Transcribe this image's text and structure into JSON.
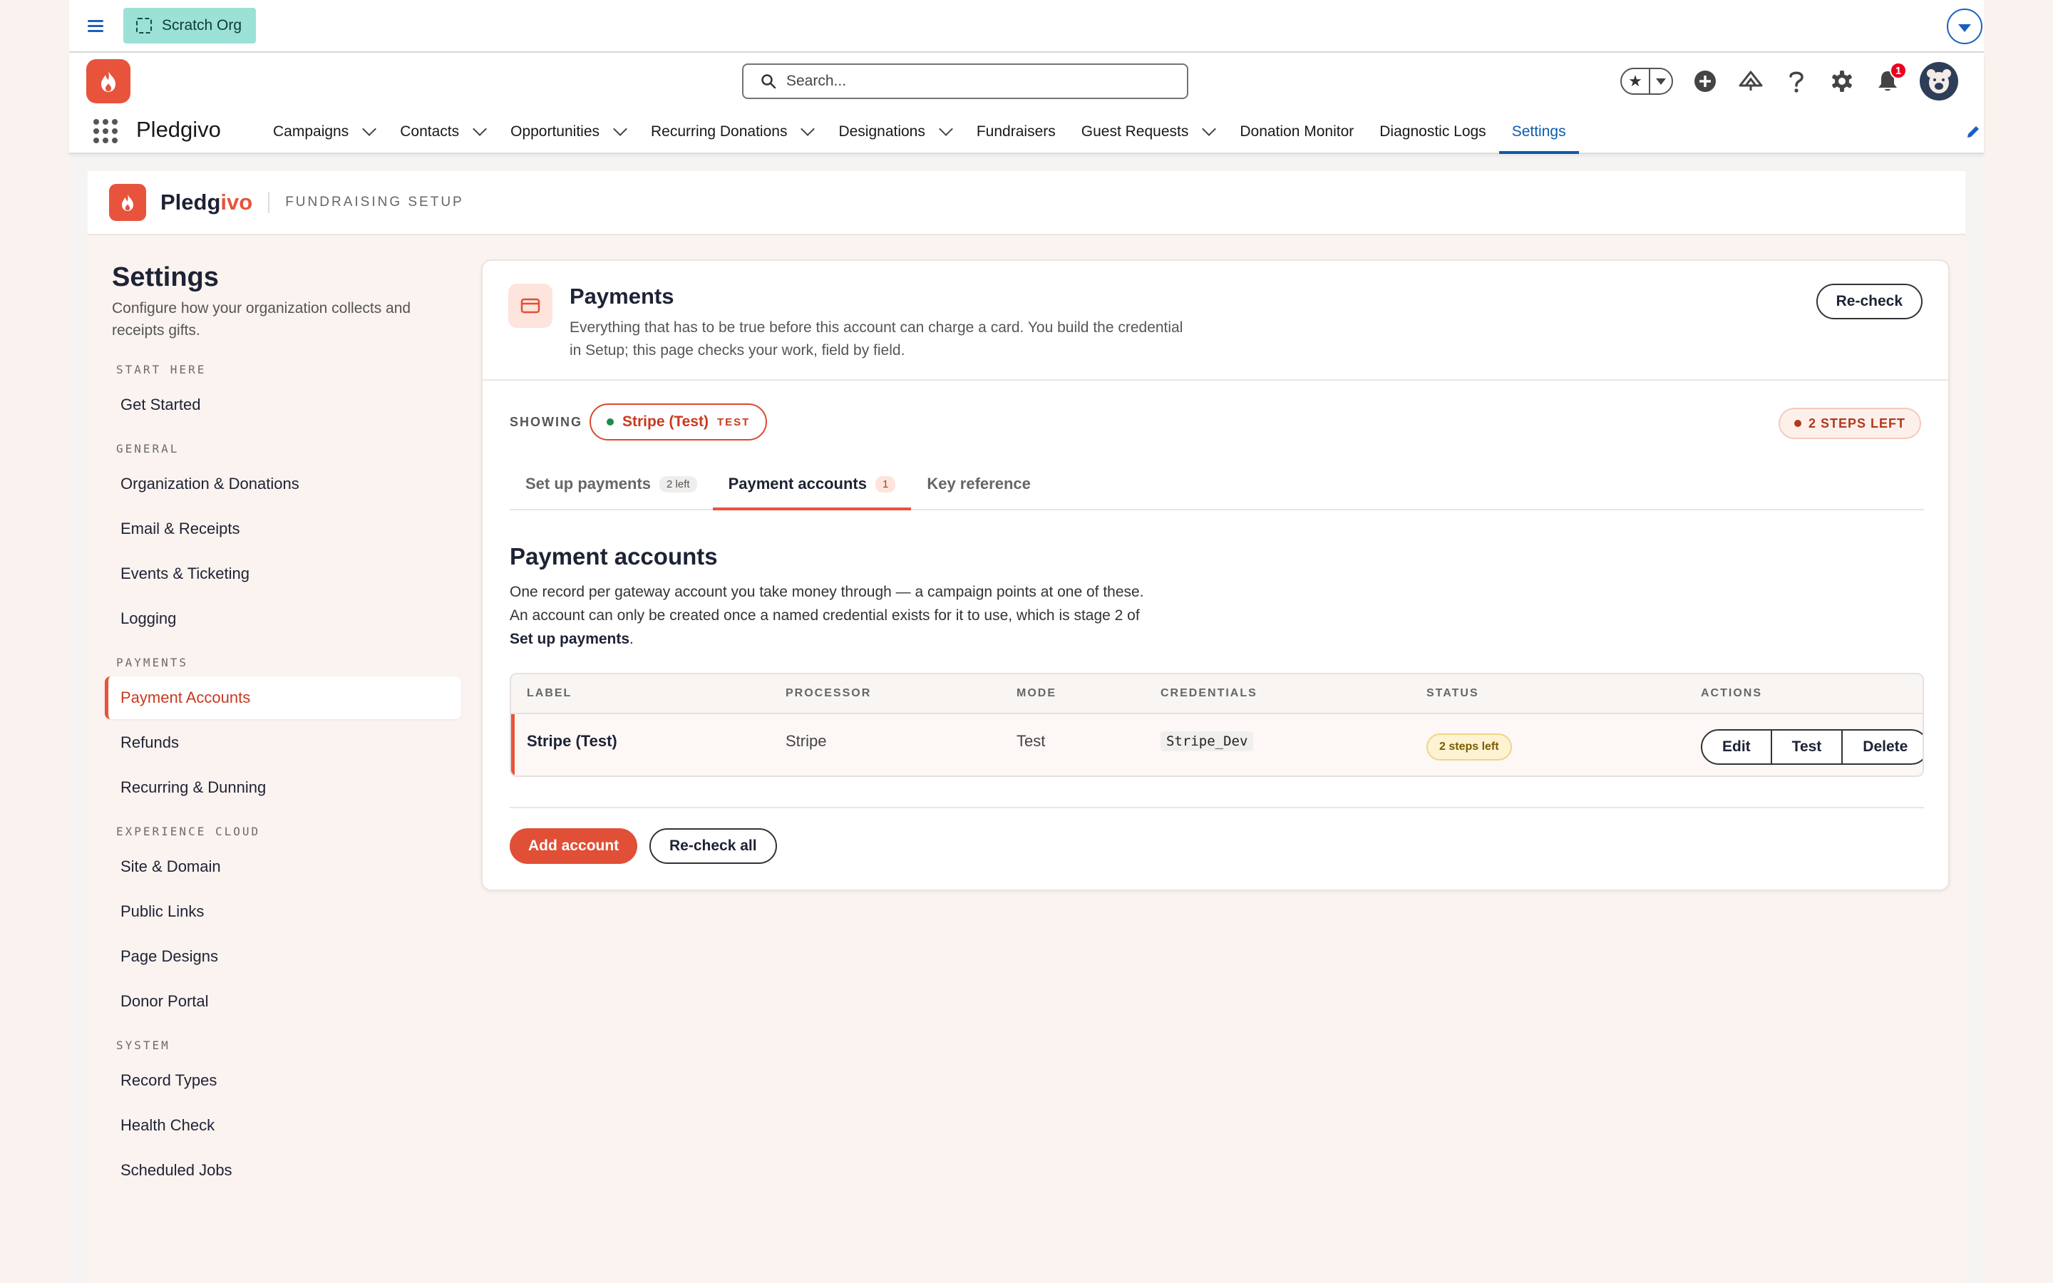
{
  "topbar": {
    "org_label": "Scratch Org"
  },
  "header": {
    "search_placeholder": "Search...",
    "notification_count": "1",
    "app_name": "Pledgivo",
    "nav": [
      {
        "label": "Campaigns",
        "has_menu": true
      },
      {
        "label": "Contacts",
        "has_menu": true
      },
      {
        "label": "Opportunities",
        "has_menu": true
      },
      {
        "label": "Recurring Donations",
        "has_menu": true
      },
      {
        "label": "Designations",
        "has_menu": true
      },
      {
        "label": "Fundraisers",
        "has_menu": false
      },
      {
        "label": "Guest Requests",
        "has_menu": true
      },
      {
        "label": "Donation Monitor",
        "has_menu": false
      },
      {
        "label": "Diagnostic Logs",
        "has_menu": false
      },
      {
        "label": "Settings",
        "has_menu": false,
        "active": true
      }
    ]
  },
  "setup_header": {
    "brand_a": "Pledg",
    "brand_b": "ivo",
    "subtitle": "FUNDRAISING SETUP"
  },
  "sidebar": {
    "title": "Settings",
    "description": "Configure how your organization collects and receipts gifts.",
    "sections": [
      {
        "heading": "START HERE",
        "items": [
          "Get Started"
        ]
      },
      {
        "heading": "GENERAL",
        "items": [
          "Organization & Donations",
          "Email & Receipts",
          "Events & Ticketing",
          "Logging"
        ]
      },
      {
        "heading": "PAYMENTS",
        "items": [
          "Payment Accounts",
          "Refunds",
          "Recurring & Dunning"
        ]
      },
      {
        "heading": "EXPERIENCE CLOUD",
        "items": [
          "Site & Domain",
          "Public Links",
          "Page Designs",
          "Donor Portal"
        ]
      },
      {
        "heading": "SYSTEM",
        "items": [
          "Record Types",
          "Health Check",
          "Scheduled Jobs"
        ]
      }
    ],
    "active_item": "Payment Accounts"
  },
  "card": {
    "title": "Payments",
    "description": "Everything that has to be true before this account can charge a card. You build the credential in Setup; this page checks your work, field by field.",
    "recheck_label": "Re-check",
    "showing_label": "SHOWING",
    "showing_account": "Stripe (Test)",
    "showing_tag": "TEST",
    "steps_left": "2 STEPS LEFT",
    "tabs": [
      {
        "label": "Set up payments",
        "count": "2 left"
      },
      {
        "label": "Payment accounts",
        "count": "1",
        "active": true
      },
      {
        "label": "Key reference",
        "count": ""
      }
    ],
    "section_title": "Payment accounts",
    "section_desc_a": "One record per gateway account you take money through — a campaign points at one of these. An account can only be created once a named credential exists for it to use, which is stage 2 of ",
    "section_desc_b": "Set up payments",
    "section_desc_c": ".",
    "table": {
      "headers": [
        "LABEL",
        "PROCESSOR",
        "MODE",
        "CREDENTIALS",
        "STATUS",
        "ACTIONS"
      ],
      "rows": [
        {
          "label": "Stripe (Test)",
          "processor": "Stripe",
          "mode": "Test",
          "credentials": "Stripe_Dev",
          "status": "2 steps left"
        }
      ],
      "actions": [
        "Edit",
        "Test",
        "Delete"
      ]
    },
    "add_account_label": "Add account",
    "recheck_all_label": "Re-check all"
  },
  "colors": {
    "brand": "#e8533c",
    "link": "#0b5cab",
    "org_badge": "#9be1d5"
  }
}
